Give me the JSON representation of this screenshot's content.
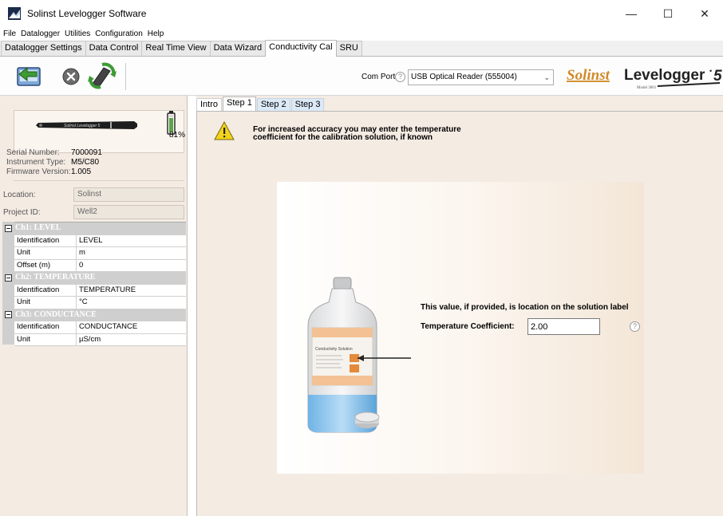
{
  "window": {
    "title": "Solinst Levelogger Software",
    "controls": {
      "minimize": "—",
      "maximize": "☐",
      "close": "✕"
    }
  },
  "menu": [
    "File",
    "Datalogger",
    "Utilities",
    "Configuration",
    "Help"
  ],
  "top_tabs": [
    {
      "label": "Datalogger Settings",
      "active": false
    },
    {
      "label": "Data Control",
      "active": false
    },
    {
      "label": "Real Time View",
      "active": false
    },
    {
      "label": "Data Wizard",
      "active": false
    },
    {
      "label": "Conductivity Cal",
      "active": true
    },
    {
      "label": "SRU",
      "active": false
    }
  ],
  "toolbar": {
    "com_port_label": "Com Port:",
    "com_port_value": "USB Optical Reader (555004)",
    "help_glyph": "?"
  },
  "brand": {
    "solinst": "Solinst",
    "product": "Levelogger",
    "version": "5",
    "model": "Model 3001"
  },
  "instrument": {
    "device_label": "Solinst Levelogger 5",
    "battery_percent": "81%",
    "serial_label": "Serial Number:",
    "serial_value": "7000091",
    "type_label": "Instrument Type:",
    "type_value": "M5/C80",
    "firmware_label": "Firmware Version:",
    "firmware_value": "1.005",
    "location_label": "Location:",
    "location_value": "Solinst",
    "project_label": "Project ID:",
    "project_value": "Well2"
  },
  "channels": [
    {
      "header": "Ch1: LEVEL",
      "rows": [
        {
          "key": "Identification",
          "value": "LEVEL"
        },
        {
          "key": "Unit",
          "value": "m"
        },
        {
          "key": "Offset (m)",
          "value": "0"
        }
      ]
    },
    {
      "header": "Ch2: TEMPERATURE",
      "rows": [
        {
          "key": "Identification",
          "value": "TEMPERATURE"
        },
        {
          "key": "Unit",
          "value": "°C"
        }
      ]
    },
    {
      "header": "Ch3: CONDUCTANCE",
      "rows": [
        {
          "key": "Identification",
          "value": "CONDUCTANCE"
        },
        {
          "key": "Unit",
          "value": "µS/cm"
        }
      ]
    }
  ],
  "sub_tabs": [
    {
      "label": "Intro",
      "active": false
    },
    {
      "label": "Step 1",
      "active": true
    },
    {
      "label": "Step 2",
      "active": false
    },
    {
      "label": "Step 3",
      "active": false
    }
  ],
  "step1": {
    "warning_line1": "For increased accuracy you may enter the temperature",
    "warning_line2": "coefficient for the calibration solution, if known",
    "bottle_label": "Conductivity Solution",
    "hint": "This value, if provided, is location on the solution label",
    "tc_label": "Temperature Coefficient:",
    "tc_value": "2.00"
  }
}
